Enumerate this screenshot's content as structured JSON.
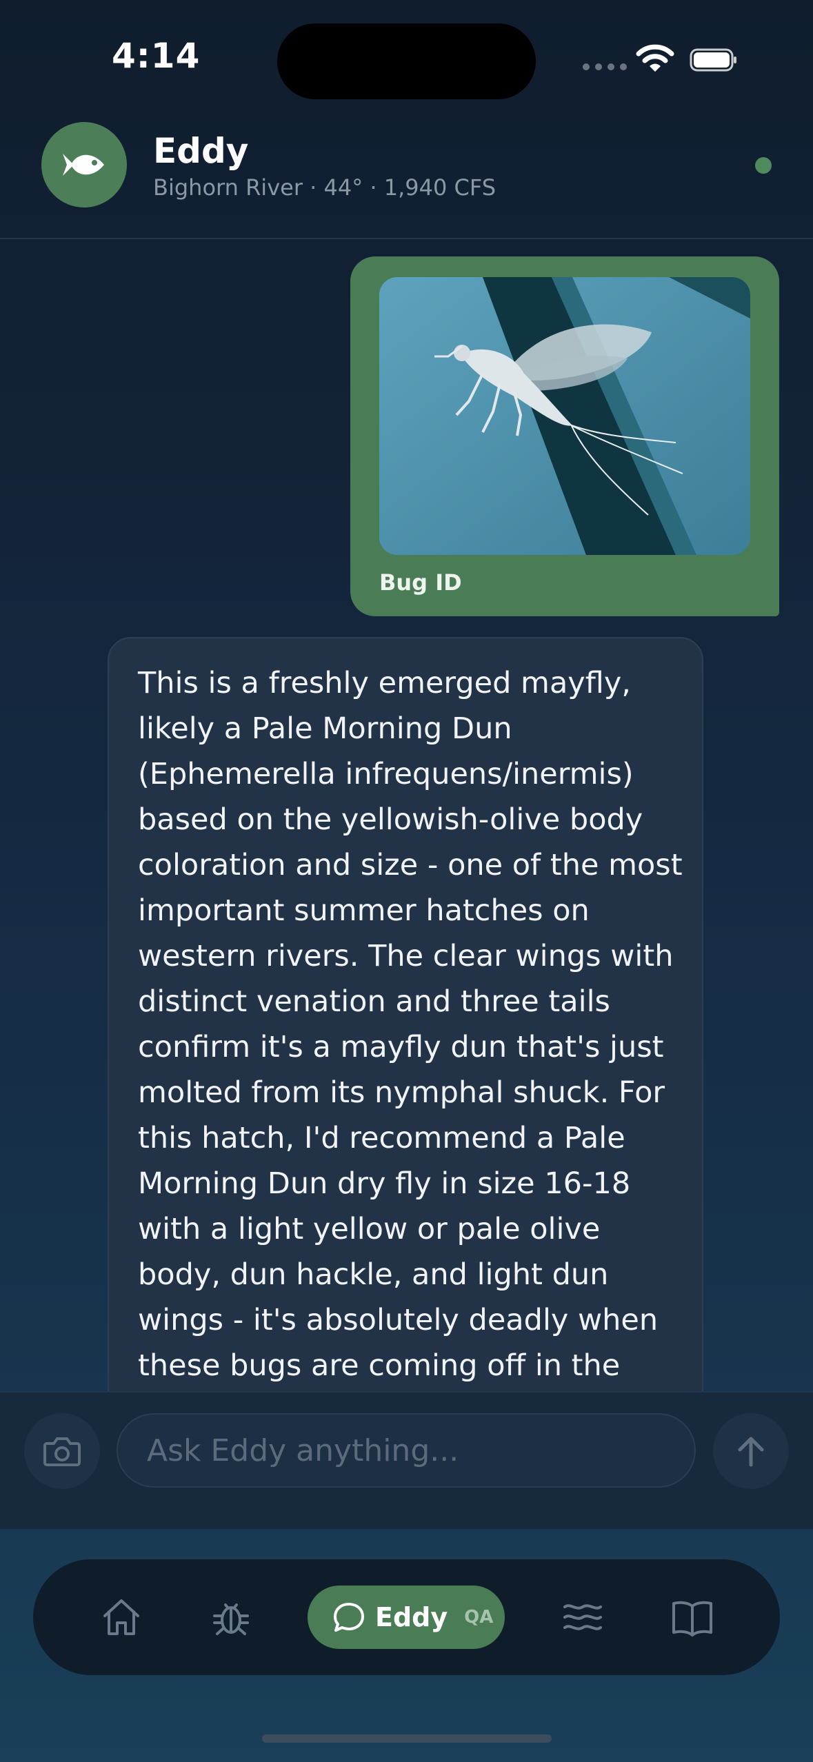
{
  "status_bar": {
    "time": "4:14"
  },
  "header": {
    "name": "Eddy",
    "subtitle": "Bighorn River · 44° · 1,940 CFS",
    "avatar_icon": "fish-icon",
    "online_color": "#4f8a5c"
  },
  "messages": [
    {
      "role": "user",
      "type": "image",
      "caption": "Bug ID",
      "bubble_color": "#4a7d56"
    },
    {
      "role": "assistant",
      "type": "text",
      "text": "This is a freshly emerged mayfly, likely a Pale Morning Dun (Ephemerella infrequens/inermis) based on the yellowish-olive body coloration and size - one of the most important summer hatches on western rivers. The clear wings with distinct venation and three tails confirm it's a mayfly dun that's just molted from its nymphal shuck. For this hatch, I'd recommend a Pale Morning Dun dry fly in size 16-18 with a light yellow or pale olive body, dun hackle, and light dun wings - it's absolutely deadly when these bugs are coming off in the"
    }
  ],
  "composer": {
    "placeholder": "Ask Eddy anything...",
    "value": "",
    "camera_icon": "camera-icon",
    "send_icon": "arrow-up-icon"
  },
  "tab_bar": {
    "tabs": [
      {
        "id": "home",
        "icon": "home-icon"
      },
      {
        "id": "bugs",
        "icon": "bug-icon"
      },
      {
        "id": "eddy",
        "icon": "chat-bubble-icon",
        "label": "Eddy",
        "badge": "QA",
        "active": true
      },
      {
        "id": "rivers",
        "icon": "waves-icon"
      },
      {
        "id": "journal",
        "icon": "book-icon"
      }
    ],
    "accent": "#4a7d56"
  }
}
